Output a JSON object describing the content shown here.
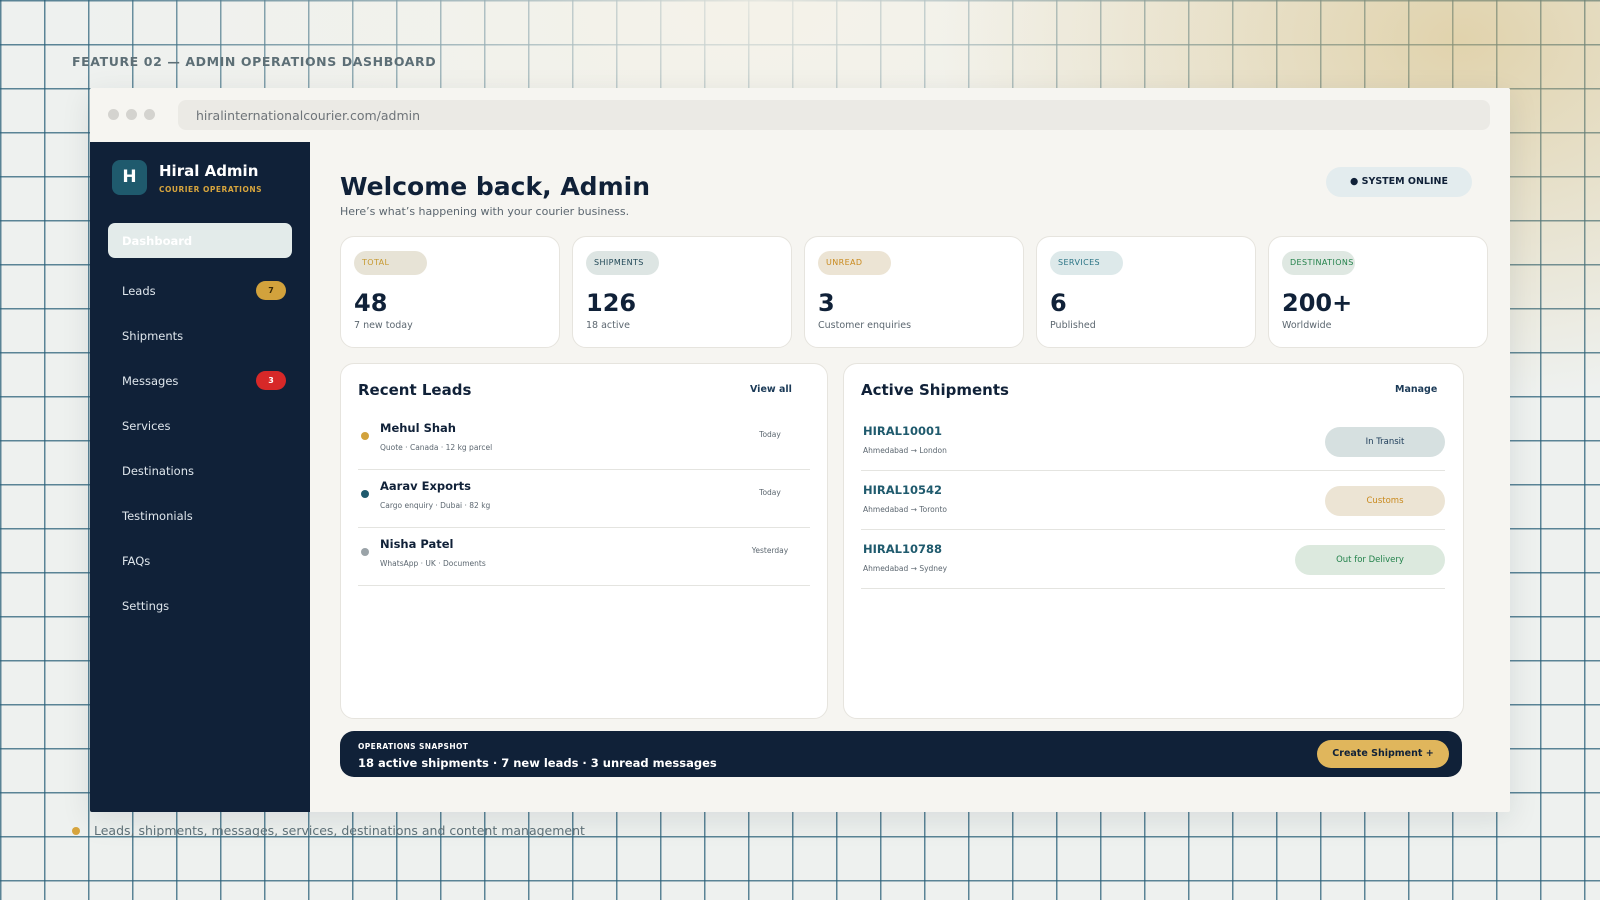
{
  "feature_label": "FEATURE 02 — ADMIN OPERATIONS DASHBOARD",
  "browser": {
    "url": "hiralinternationalcourier.com/admin"
  },
  "sidebar": {
    "brand_initial": "H",
    "brand_name": "Hiral Admin",
    "brand_sub": "COURIER OPERATIONS",
    "items": [
      {
        "label": "Dashboard",
        "badge": ""
      },
      {
        "label": "Leads",
        "badge": "7"
      },
      {
        "label": "Shipments",
        "badge": ""
      },
      {
        "label": "Messages",
        "badge": "3"
      },
      {
        "label": "Services",
        "badge": ""
      },
      {
        "label": "Destinations",
        "badge": ""
      },
      {
        "label": "Testimonials",
        "badge": ""
      },
      {
        "label": "FAQs",
        "badge": ""
      },
      {
        "label": "Settings",
        "badge": ""
      }
    ]
  },
  "header": {
    "title": "Welcome back, Admin",
    "subtitle": "Here’s what’s happening with your courier business.",
    "status": "● SYSTEM ONLINE"
  },
  "stats": [
    {
      "tag": "TOTAL",
      "value": "48",
      "note": "7 new today"
    },
    {
      "tag": "SHIPMENTS",
      "value": "126",
      "note": "18 active"
    },
    {
      "tag": "UNREAD",
      "value": "3",
      "note": "Customer enquiries"
    },
    {
      "tag": "SERVICES",
      "value": "6",
      "note": "Published"
    },
    {
      "tag": "DESTINATIONS",
      "value": "200+",
      "note": "Worldwide"
    }
  ],
  "leads": {
    "title": "Recent Leads",
    "link": "View all",
    "rows": [
      {
        "name": "Mehul Shah",
        "meta": "Quote · Canada · 12 kg parcel",
        "time": "Today",
        "dot_color": "#d2a23c"
      },
      {
        "name": "Aarav Exports",
        "meta": "Cargo enquiry · Dubai · 82 kg",
        "time": "Today",
        "dot_color": "#1f5a6d"
      },
      {
        "name": "Nisha Patel",
        "meta": "WhatsApp · UK · Documents",
        "time": "Yesterday",
        "dot_color": "#9aa3a8"
      }
    ]
  },
  "shipments": {
    "title": "Active Shipments",
    "link": "Manage",
    "rows": [
      {
        "id": "HIRAL10001",
        "route": "Ahmedabad → London",
        "status": "In Transit"
      },
      {
        "id": "HIRAL10542",
        "route": "Ahmedabad → Toronto",
        "status": "Customs"
      },
      {
        "id": "HIRAL10788",
        "route": "Ahmedabad → Sydney",
        "status": "Out for Delivery"
      }
    ]
  },
  "snapshot": {
    "label": "OPERATIONS SNAPSHOT",
    "text": "18 active shipments · 7 new leads · 3 unread messages",
    "button": "Create Shipment +"
  },
  "footer": {
    "text": "Leads, shipments, messages, services, destinations and content management"
  },
  "colors": {
    "navy": "#102138",
    "gold": "#d2a23c",
    "teal": "#1f5a6d",
    "red": "#d72828",
    "green": "#23824b"
  }
}
